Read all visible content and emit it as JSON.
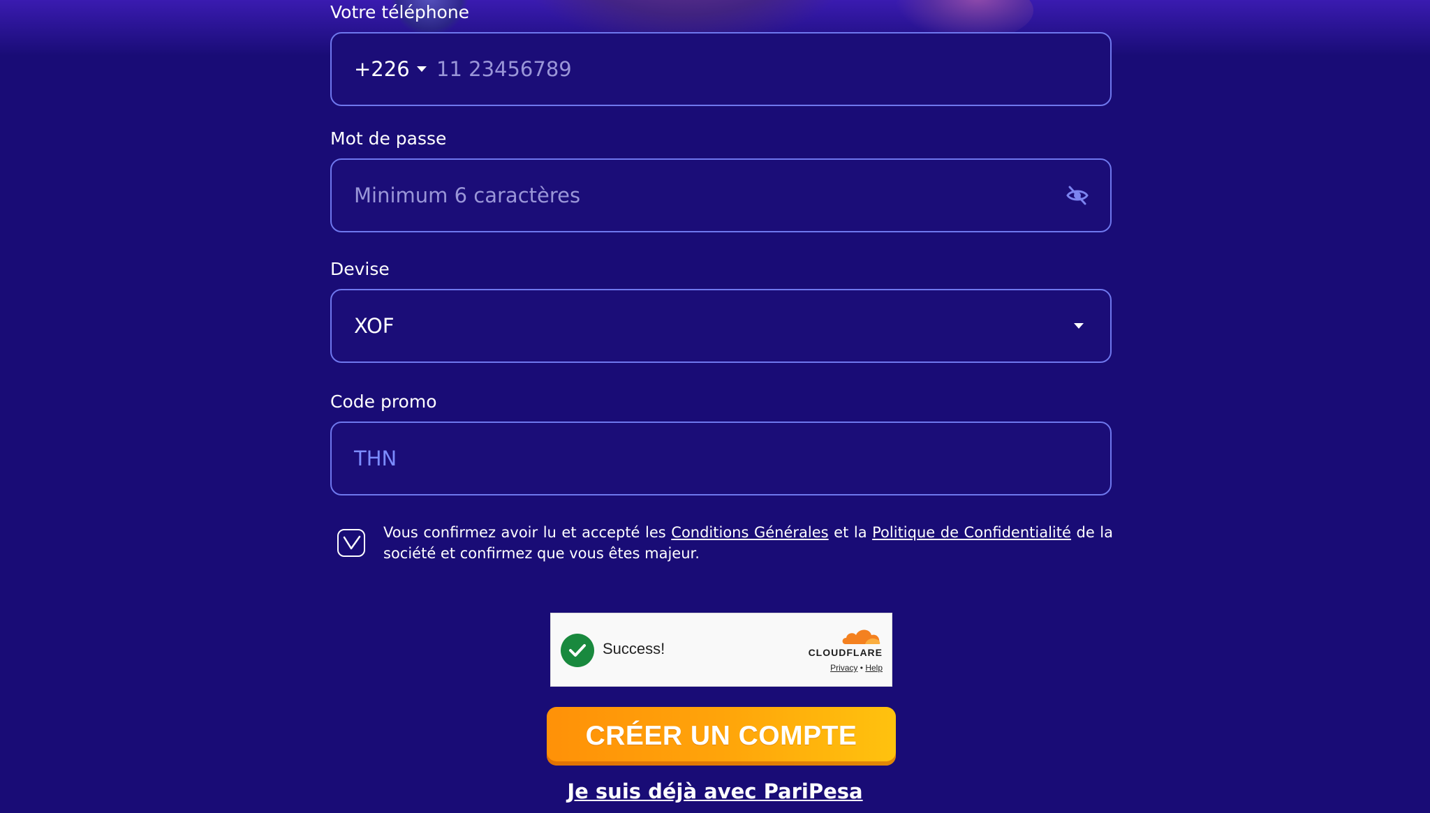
{
  "phone": {
    "label": "Votre téléphone",
    "country_code": "+226",
    "placeholder": "11 23456789"
  },
  "password": {
    "label": "Mot de passe",
    "placeholder": "Minimum 6 caractères",
    "toggle_icon": "eye-off-icon"
  },
  "currency": {
    "label": "Devise",
    "selected": "XOF"
  },
  "promo": {
    "label": "Code promo",
    "value": "THN"
  },
  "terms": {
    "checked": true,
    "text_before": "Vous confirmez avoir lu et accepté les ",
    "link_conditions": "Conditions Générales",
    "text_middle": " et la ",
    "link_privacy": "Politique de Confidentialité",
    "text_after": " de la société et confirmez que vous êtes majeur."
  },
  "captcha": {
    "status": "Success!",
    "brand": "CLOUDFLARE",
    "privacy_link": "Privacy",
    "separator": "•",
    "help_link": "Help"
  },
  "submit": {
    "label": "CRÉER UN COMPTE"
  },
  "login_link": {
    "label": "Je suis déjà avec PariPesa"
  },
  "colors": {
    "background": "#190c76",
    "field_border": "#6f78ee",
    "button_start": "#ff9108",
    "button_end": "#ffc20e",
    "captcha_success": "#19893e"
  }
}
